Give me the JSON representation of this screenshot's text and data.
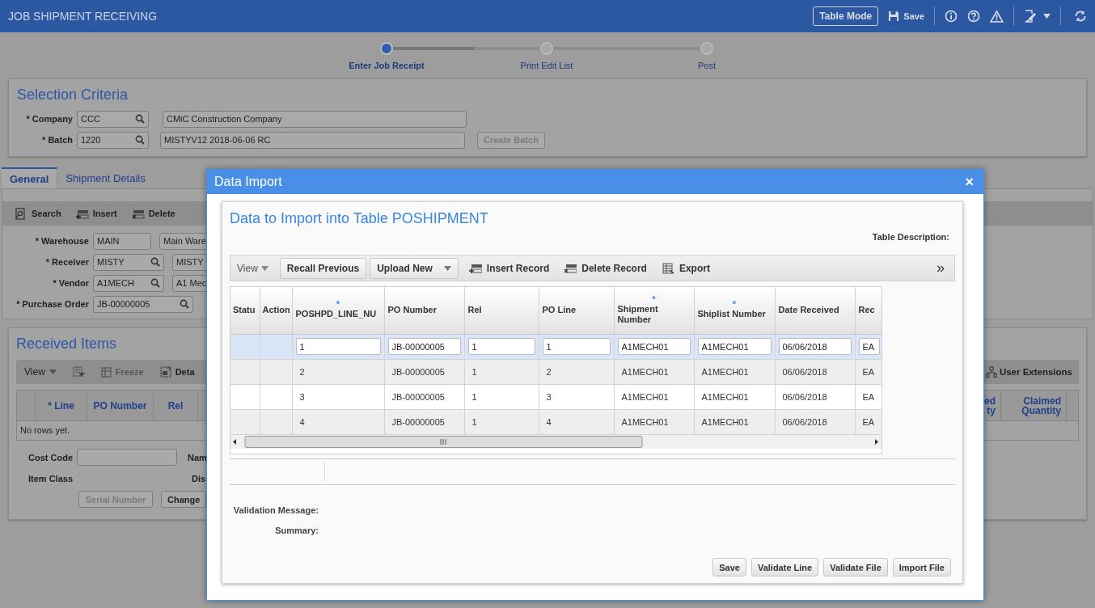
{
  "app_header": {
    "title": "JOB SHIPMENT RECEIVING",
    "table_mode_button": "Table Mode",
    "save_button": "Save"
  },
  "stepper": [
    {
      "label": "Enter Job Receipt",
      "selected": true
    },
    {
      "label": "Print Edit List",
      "selected": false
    },
    {
      "label": "Post",
      "selected": false
    }
  ],
  "selection_criteria": {
    "title": "Selection Criteria",
    "fields": [
      {
        "label": "* Company",
        "value": "CCC",
        "lookup": true,
        "description": "CMiC Construction Company"
      },
      {
        "label": "* Batch",
        "value": "1220",
        "lookup": true,
        "description": "MISTYV12 2018-06-06 RC"
      }
    ],
    "create_batch_button": {
      "label": "Create Batch",
      "disabled": true
    }
  },
  "tabs": [
    {
      "label": "General",
      "selected": true
    },
    {
      "label": "Shipment Details",
      "selected": false
    }
  ],
  "general": {
    "toolbar": [
      {
        "label": "Search",
        "kind": "search"
      },
      {
        "label": "Insert",
        "kind": "insert"
      },
      {
        "label": "Delete",
        "kind": "delete"
      }
    ],
    "fields": [
      {
        "label": "* Warehouse",
        "value": "MAIN",
        "lookup": false,
        "description": "Main Ware"
      },
      {
        "label": "* Receiver",
        "value": "MISTY",
        "lookup": true,
        "description": "MISTY"
      },
      {
        "label": "* Vendor",
        "value": "A1MECH",
        "lookup": true,
        "description": "A1 Mec"
      },
      {
        "label": "* Purchase Order",
        "value": "JB-00000005",
        "lookup": true
      }
    ]
  },
  "received_items": {
    "title": "Received Items",
    "toolbar": {
      "view": "View",
      "freeze": {
        "label": "Freeze",
        "disabled": true
      },
      "detach": "Deta",
      "user_extensions": "User Extensions"
    },
    "columns": [
      "* Line",
      "PO Number",
      "Rel"
    ],
    "right_columns": [
      "ed ty",
      "Claimed Quantity"
    ],
    "empty_message": "No rows yet.",
    "cost_code_label": "Cost Code",
    "name_label": "Nam",
    "item_class_label": "Item Class",
    "dis_label": "Dis",
    "buttons": [
      {
        "label": "Serial Number",
        "disabled": true
      },
      {
        "label": "Change",
        "disabled": false
      }
    ]
  },
  "data_import_dialog": {
    "title": "Data Import",
    "close": "×",
    "heading": "Data to Import into Table POSHIPMENT",
    "table_description_label": "Table Description:",
    "toolbar": {
      "view": "View",
      "items": [
        {
          "label": "Recall Previous",
          "kind": "button"
        },
        {
          "label": "Upload New",
          "kind": "dropdown"
        },
        {
          "label": "Insert Record",
          "kind": "insert"
        },
        {
          "label": "Delete Record",
          "kind": "delete"
        },
        {
          "label": "Export",
          "kind": "export"
        }
      ],
      "more": "»"
    },
    "grid": {
      "columns": [
        {
          "label": "Statu",
          "kind": "marker"
        },
        {
          "label": "Action",
          "kind": "marker"
        },
        {
          "label": "POSHPD_LINE_NU",
          "mark": "*",
          "kind": "data"
        },
        {
          "label": "PO Number",
          "kind": "data"
        },
        {
          "label": "Rel",
          "kind": "data"
        },
        {
          "label": "PO Line",
          "kind": "data"
        },
        {
          "label": "Shipment Number",
          "mark": "*",
          "kind": "data"
        },
        {
          "label": "Shiplist Number",
          "mark": "*",
          "kind": "data"
        },
        {
          "label": "Date Received",
          "kind": "data"
        },
        {
          "label": "Rec",
          "kind": "data"
        }
      ],
      "rows": [
        {
          "selected": true,
          "cells": [
            "",
            "",
            "1",
            "JB-00000005",
            "1",
            "1",
            "A1MECH01",
            "A1MECH01",
            "06/06/2018",
            "EA"
          ]
        },
        {
          "selected": false,
          "cells": [
            "",
            "",
            "2",
            "JB-00000005",
            "1",
            "2",
            "A1MECH01",
            "A1MECH01",
            "06/06/2018",
            "EA"
          ]
        },
        {
          "selected": false,
          "cells": [
            "",
            "",
            "3",
            "JB-00000005",
            "1",
            "3",
            "A1MECH01",
            "A1MECH01",
            "06/06/2018",
            "EA"
          ]
        },
        {
          "selected": false,
          "cells": [
            "",
            "",
            "4",
            "JB-00000005",
            "1",
            "4",
            "A1MECH01",
            "A1MECH01",
            "06/06/2018",
            "EA"
          ]
        }
      ]
    },
    "validation_message_label": "Validation Message:",
    "summary_label": "Summary:",
    "buttons": [
      "Save",
      "Validate Line",
      "Validate File",
      "Import File"
    ]
  }
}
